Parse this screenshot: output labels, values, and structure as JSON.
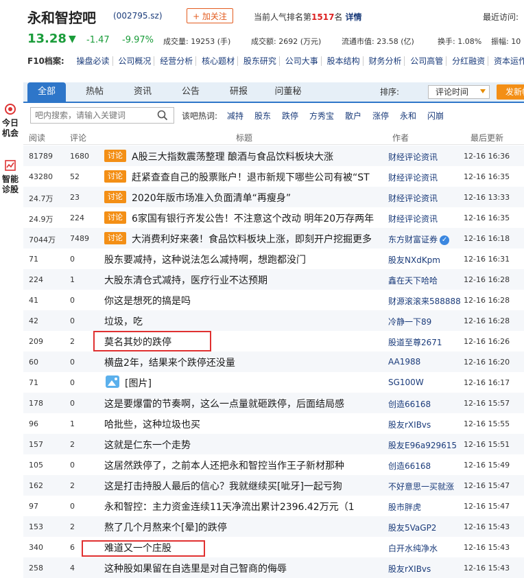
{
  "header": {
    "title": "永和智控吧",
    "code": "(002795.sz)",
    "follow_label": "+ 加关注",
    "rank_prefix": "当前人气排名第",
    "rank_number": "1517",
    "rank_suffix": "名",
    "detail_link": "详情",
    "recent_label": "最近访问:"
  },
  "quote": {
    "price": "13.28",
    "arrow": "▼",
    "change": "-1.47",
    "change_pct": "-9.97%",
    "volume": "成交量: 19253 (手)",
    "amount": "成交额: 2692 (万元)",
    "market_cap": "流通市值: 23.58 (亿)",
    "turnover": "换手: 1.08%",
    "amplitude": "振幅: 10"
  },
  "f10": {
    "label": "F10档案:",
    "links": [
      "操盘必读",
      "公司概况",
      "经营分析",
      "核心题材",
      "股东研究",
      "公司大事",
      "股本结构",
      "财务分析",
      "公司高管",
      "分红融资",
      "资本运作"
    ]
  },
  "tabs": [
    "全部",
    "热帖",
    "资讯",
    "公告",
    "研报",
    "问董秘"
  ],
  "sort": {
    "label": "排序:",
    "selected": "评论时间",
    "post_button": "发新帖"
  },
  "side": [
    {
      "label1": "今日",
      "label2": "机会",
      "icon": "target-icon"
    },
    {
      "label1": "智能",
      "label2": "诊股",
      "icon": "chart-icon"
    }
  ],
  "search": {
    "placeholder": "吧内搜索，请输入关键词",
    "hot_label": "该吧热词:",
    "hot_words": [
      "减持",
      "股东",
      "跌停",
      "方秀宝",
      "散户",
      "涨停",
      "永和",
      "闪崩"
    ]
  },
  "columns": [
    "阅读",
    "评论",
    "标题",
    "作者",
    "最后更新"
  ],
  "badge_label": "讨论",
  "posts": [
    {
      "read": "81789",
      "comments": "1680",
      "title": "A股三大指数震荡整理 酿酒与食品饮料板块大涨",
      "author": "财经评论资讯",
      "time": "12-16 16:36",
      "badge": true
    },
    {
      "read": "43280",
      "comments": "52",
      "title": "赶紧查查自己的股票账户！退市新规下哪些公司有被“ST",
      "author": "财经评论资讯",
      "time": "12-16 16:35",
      "badge": true
    },
    {
      "read": "24.7万",
      "comments": "23",
      "title": "2020年版市场准入负面清单“再瘦身”",
      "author": "财经评论资讯",
      "time": "12-16 13:33",
      "badge": true
    },
    {
      "read": "24.9万",
      "comments": "224",
      "title": "6家国有银行齐发公告！不注意这个改动 明年20万存两年",
      "author": "财经评论资讯",
      "time": "12-16 16:35",
      "badge": true
    },
    {
      "read": "7044万",
      "comments": "7489",
      "title": "大消费利好来袭！食品饮料板块上涨，即刻开户挖掘更多",
      "author": "东方财富证券",
      "time": "12-16 16:18",
      "badge": true,
      "verified": true
    },
    {
      "read": "71",
      "comments": "0",
      "title": "股东要减持，这种说法怎么减持啊，想跑都没门",
      "author": "股友NXdKpm",
      "time": "12-16 16:31"
    },
    {
      "read": "224",
      "comments": "1",
      "title": "大股东清仓式减持，医疗行业不达预期",
      "author": "鑫在天下哈哈",
      "time": "12-16 16:28"
    },
    {
      "read": "41",
      "comments": "0",
      "title": "你这是想死的搞是吗",
      "author": "财源滚滚来588888",
      "time": "12-16 16:28"
    },
    {
      "read": "42",
      "comments": "0",
      "title": "垃圾，吃",
      "author": "冷静一下89",
      "time": "12-16 16:28"
    },
    {
      "read": "209",
      "comments": "2",
      "title": "莫名其妙的跌停",
      "author": "股道至尊2671",
      "time": "12-16 16:26"
    },
    {
      "read": "60",
      "comments": "0",
      "title": "横盘2年，结果来个跌停还没量",
      "author": "AA1988",
      "time": "12-16 16:20"
    },
    {
      "read": "71",
      "comments": "0",
      "title": "[图片]",
      "author": "SG100W",
      "time": "12-16 16:17",
      "image": true
    },
    {
      "read": "178",
      "comments": "0",
      "title": "这是要爆雷的节奏啊，这么一点量就砸跌停，后面结局感",
      "author": "创造66168",
      "time": "12-16 15:57"
    },
    {
      "read": "96",
      "comments": "1",
      "title": "哈批些，这种垃圾也买",
      "author": "股友rXIBvs",
      "time": "12-16 15:55"
    },
    {
      "read": "157",
      "comments": "2",
      "title": "这就是仁东一个走势",
      "author": "股友E96a929615",
      "time": "12-16 15:51"
    },
    {
      "read": "105",
      "comments": "0",
      "title": "这居然跌停了，之前本人还把永和智控当作王子新材那种",
      "author": "创造66168",
      "time": "12-16 15:49"
    },
    {
      "read": "162",
      "comments": "2",
      "title": "这是打击持股人最后的信心？我就继续买[呲牙]一起亏狗",
      "author": "不好意思一买就涨",
      "time": "12-16 15:47"
    },
    {
      "read": "97",
      "comments": "0",
      "title": "永和智控：主力资金连续11天净流出累计2396.42万元（1",
      "author": "股市胖虎",
      "time": "12-16 15:47"
    },
    {
      "read": "153",
      "comments": "2",
      "title": "熬了几个月熬来个[晕]的跌停",
      "author": "股友5VaGP2",
      "time": "12-16 15:43"
    },
    {
      "read": "340",
      "comments": "6",
      "title": "难道又一个庄股",
      "author": "白开水纯净水",
      "time": "12-16 15:43"
    },
    {
      "read": "258",
      "comments": "4",
      "title": "这种股如果留在自选里是对自己智商的侮辱",
      "author": "股友rXIBvs",
      "time": "12-16 15:43"
    }
  ]
}
